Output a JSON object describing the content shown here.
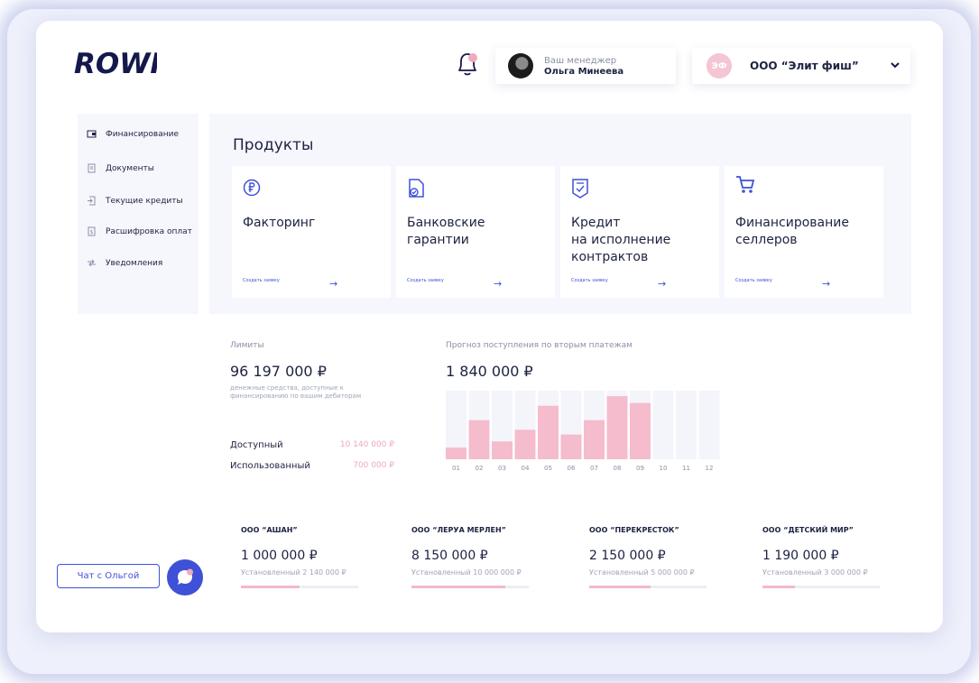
{
  "header": {
    "logo": "ROWI",
    "manager_label": "Ваш менеджер",
    "manager_name": "Ольга Минеева",
    "company_badge": "ЭФ",
    "company_name": "ООО “Элит фиш”"
  },
  "sidebar": {
    "items": [
      {
        "label": "Финансирование",
        "icon": "wallet-icon"
      },
      {
        "label": "Документы",
        "icon": "document-icon"
      },
      {
        "label": "Текущие кредиты",
        "icon": "credit-icon"
      },
      {
        "label": "Расшифровка оплат",
        "icon": "receipt-icon"
      },
      {
        "label": "Уведомления",
        "icon": "notification-icon"
      }
    ]
  },
  "products": {
    "title": "Продукты",
    "cards": [
      {
        "title": "Факторинг",
        "link": "Создать заявку",
        "icon": "ruble-icon"
      },
      {
        "title": "Банковские\nгарантии",
        "link": "Создать заявку",
        "icon": "guarantee-icon"
      },
      {
        "title": "Кредит\nна исполнение\nконтрактов",
        "link": "Создать заявку",
        "icon": "contract-icon"
      },
      {
        "title": "Финансирование\nселлеров",
        "link": "Создать заявку",
        "icon": "cart-icon"
      }
    ]
  },
  "limits": {
    "label": "Лимиты",
    "value": "96 197 000 ₽",
    "description": "денежные средства, доступные к финансированию по вашим дебиторам",
    "available_label": "Доступный",
    "available_value": "10 140 000 ₽",
    "used_label": "Использованный",
    "used_value": "700 000 ₽"
  },
  "forecast": {
    "label": "Прогноз поступления по вторым платежам",
    "value": "1 840 000 ₽"
  },
  "chart_data": {
    "type": "bar",
    "categories": [
      "01",
      "02",
      "03",
      "04",
      "05",
      "06",
      "07",
      "08",
      "09",
      "10",
      "11",
      "12"
    ],
    "values": [
      0.17,
      0.57,
      0.26,
      0.43,
      0.78,
      0.36,
      0.57,
      0.92,
      0.82,
      0,
      0,
      0
    ],
    "ylim": [
      0,
      1
    ],
    "bar_color": "#f4bccc",
    "track_color": "#f4f5fb"
  },
  "chat": {
    "label": "Чат с Ольгой"
  },
  "clients": [
    {
      "name": "ООО “АШАН”",
      "value": "1 000 000 ₽",
      "set": "Установленный 2 140 000 ₽",
      "progress": 0.5
    },
    {
      "name": "ООО “ЛЕРУА МЕРЛЕН”",
      "value": "8 150 000 ₽",
      "set": "Установленный 10 000 000 ₽",
      "progress": 0.8
    },
    {
      "name": "ООО “ПЕРЕКРЕСТОК”",
      "value": "2 150 000 ₽",
      "set": "Установленный 5 000 000 ₽",
      "progress": 0.52
    },
    {
      "name": "ООО “ДЕТСКИЙ МИР”",
      "value": "1 190 000 ₽",
      "set": "Установленный 3 000 000 ₽",
      "progress": 0.28
    }
  ],
  "colors": {
    "accent": "#3f51d6",
    "pink": "#f4bccc",
    "panel": "#f6f7fd"
  }
}
